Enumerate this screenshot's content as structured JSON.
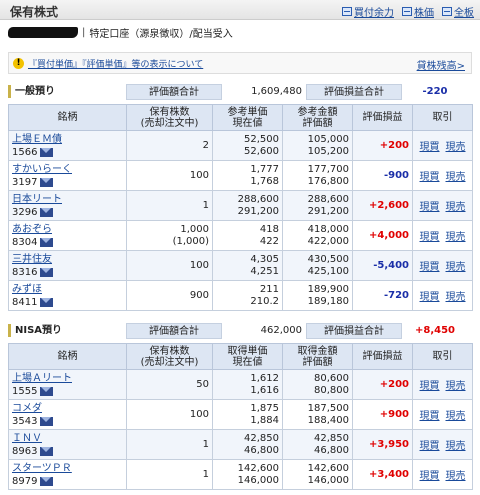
{
  "header": {
    "title": "保有株式",
    "links": [
      {
        "label": "買付余力",
        "icon": "calculator-icon"
      },
      {
        "label": "株価",
        "icon": "price-board-icon"
      },
      {
        "label": "全板",
        "icon": "order-board-icon"
      }
    ]
  },
  "account": {
    "label": "特定口座（源泉徴収）/配当受入"
  },
  "notice": {
    "text": "『買付単価』『評価単価』等の表示について",
    "right_link": "貸株残高>"
  },
  "general": {
    "label": "一般預り",
    "eval_total_label": "評価額合計",
    "eval_total": "1,609,480",
    "pl_total_label": "評価損益合計",
    "pl_total": "-220",
    "headers": [
      "銘柄",
      "保有株数\n(売却注文中)",
      "参考単価\n現在値",
      "参考金額\n評価額",
      "評価損益",
      "取引"
    ],
    "rows": [
      {
        "name": "上場ＥＭ債",
        "code": "1566",
        "qty": "2",
        "qty2": "",
        "price1": "52,500",
        "price2": "52,600",
        "amt1": "105,000",
        "amt2": "105,200",
        "pl": "+200"
      },
      {
        "name": "すかいらーく",
        "code": "3197",
        "qty": "100",
        "qty2": "",
        "price1": "1,777",
        "price2": "1,768",
        "amt1": "177,700",
        "amt2": "176,800",
        "pl": "-900"
      },
      {
        "name": "日本リート",
        "code": "3296",
        "qty": "1",
        "qty2": "",
        "price1": "288,600",
        "price2": "291,200",
        "amt1": "288,600",
        "amt2": "291,200",
        "pl": "+2,600"
      },
      {
        "name": "あおぞら",
        "code": "8304",
        "qty": "1,000",
        "qty2": "(1,000)",
        "price1": "418",
        "price2": "422",
        "amt1": "418,000",
        "amt2": "422,000",
        "pl": "+4,000"
      },
      {
        "name": "三井住友",
        "code": "8316",
        "qty": "100",
        "qty2": "",
        "price1": "4,305",
        "price2": "4,251",
        "amt1": "430,500",
        "amt2": "425,100",
        "pl": "-5,400"
      },
      {
        "name": "みずほ",
        "code": "8411",
        "qty": "900",
        "qty2": "",
        "price1": "211",
        "price2": "210.2",
        "amt1": "189,900",
        "amt2": "189,180",
        "pl": "-720"
      }
    ]
  },
  "nisa": {
    "label": "NISA預り",
    "eval_total_label": "評価額合計",
    "eval_total": "462,000",
    "pl_total_label": "評価損益合計",
    "pl_total": "+8,450",
    "headers": [
      "銘柄",
      "保有株数\n(売却注文中)",
      "取得単価\n現在値",
      "取得金額\n評価額",
      "評価損益",
      "取引"
    ],
    "rows": [
      {
        "name": "上場Ａリート",
        "code": "1555",
        "qty": "50",
        "qty2": "",
        "price1": "1,612",
        "price2": "1,616",
        "amt1": "80,600",
        "amt2": "80,800",
        "pl": "+200"
      },
      {
        "name": "コメダ",
        "code": "3543",
        "qty": "100",
        "qty2": "",
        "price1": "1,875",
        "price2": "1,884",
        "amt1": "187,500",
        "amt2": "188,400",
        "pl": "+900"
      },
      {
        "name": "ＩＮＶ",
        "code": "8963",
        "qty": "1",
        "qty2": "",
        "price1": "42,850",
        "price2": "46,800",
        "amt1": "42,850",
        "amt2": "46,800",
        "pl": "+3,950"
      },
      {
        "name": "スターツＰＲ",
        "code": "8979",
        "qty": "1",
        "qty2": "",
        "price1": "142,600",
        "price2": "146,000",
        "amt1": "142,600",
        "amt2": "146,000",
        "pl": "+3,400"
      }
    ]
  },
  "actions": {
    "buy": "現買",
    "sell": "現売"
  },
  "colors": {
    "positive": "#e00000",
    "negative": "#1a2ea8",
    "header_bg": "#dde6f3",
    "link": "#1a4a9a"
  }
}
